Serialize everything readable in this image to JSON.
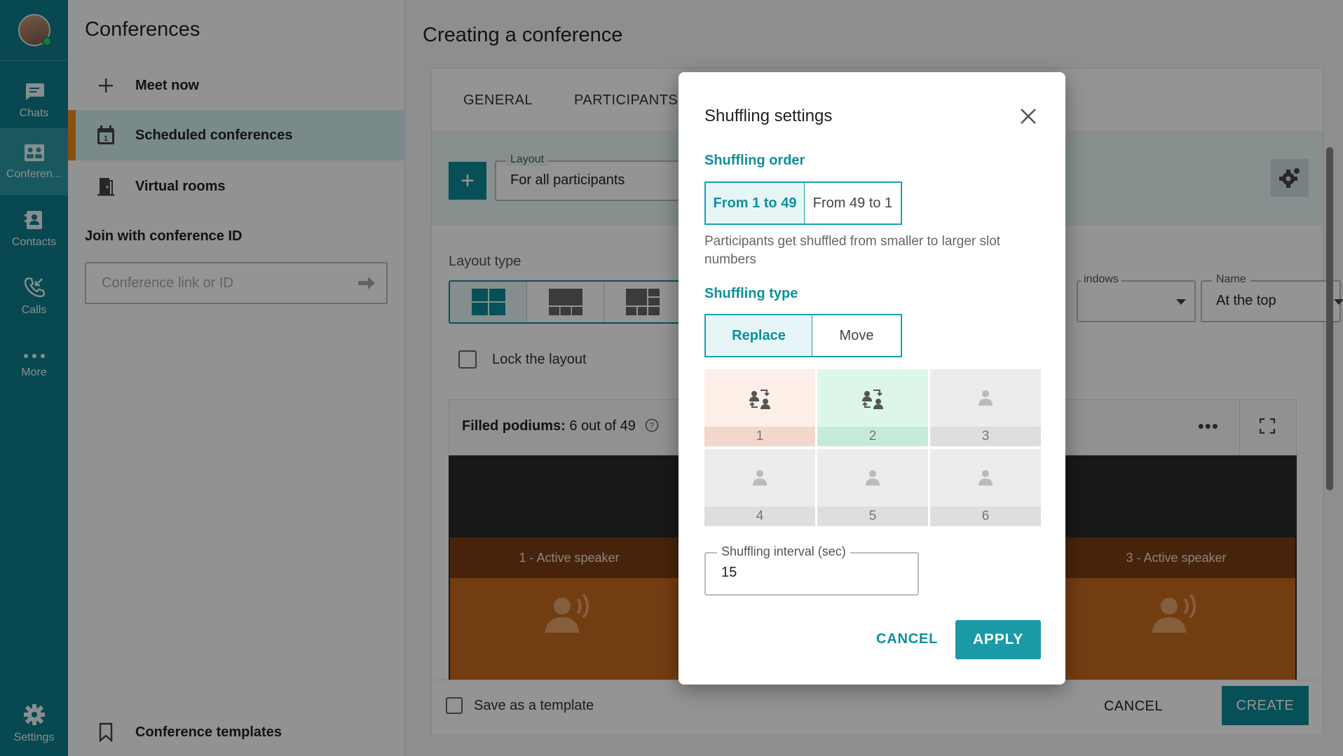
{
  "rail": {
    "items": [
      {
        "label": "Chats",
        "icon": "chat-icon"
      },
      {
        "label": "Conferen...",
        "icon": "conference-icon"
      },
      {
        "label": "Contacts",
        "icon": "contacts-icon"
      },
      {
        "label": "Calls",
        "icon": "calls-icon"
      },
      {
        "label": "More",
        "icon": "more-dots-icon"
      }
    ],
    "settings_label": "Settings",
    "status_color": "#2fd14f"
  },
  "panel": {
    "title": "Conferences",
    "items": [
      {
        "label": "Meet now",
        "icon": "plus-icon"
      },
      {
        "label": "Scheduled conferences",
        "icon": "calendar-icon"
      },
      {
        "label": "Virtual rooms",
        "icon": "door-icon"
      }
    ],
    "join_title": "Join with conference ID",
    "join_placeholder": "Conference link or ID",
    "templates_label": "Conference templates"
  },
  "main": {
    "title": "Creating a conference",
    "tabs": [
      "GENERAL",
      "PARTICIPANTS("
    ],
    "layout_field_label": "Layout",
    "layout_field_value": "For all participants",
    "layout_type_label": "Layout type",
    "lock_label": "Lock the layout",
    "windows_label": "indows",
    "name_label": "Name",
    "name_value": "At the top",
    "filled_label": "Filled podiums:",
    "filled_value": "6 out of 49",
    "slots": [
      "1 - Active speaker",
      "3 - Active speaker"
    ],
    "save_template_label": "Save as a template",
    "cancel_label": "CANCEL",
    "create_label": "CREATE"
  },
  "modal": {
    "title": "Shuffling settings",
    "order_title": "Shuffling order",
    "order_options": [
      "From 1 to 49",
      "From 49 to 1"
    ],
    "order_selected": "From 1 to 49",
    "order_desc": "Participants get shuffled from smaller to larger slot numbers",
    "type_title": "Shuffling type",
    "type_options": [
      "Replace",
      "Move"
    ],
    "type_selected": "Replace",
    "grid": [
      "1",
      "2",
      "3",
      "4",
      "5",
      "6"
    ],
    "interval_label": "Shuffling interval (sec)",
    "interval_value": "15",
    "cancel_label": "CANCEL",
    "apply_label": "APPLY"
  },
  "colors": {
    "accent": "#0e8a96",
    "rail": "#0e7d8a",
    "active_marker": "#f08a1c",
    "slot_orange": "#c76a1f"
  }
}
